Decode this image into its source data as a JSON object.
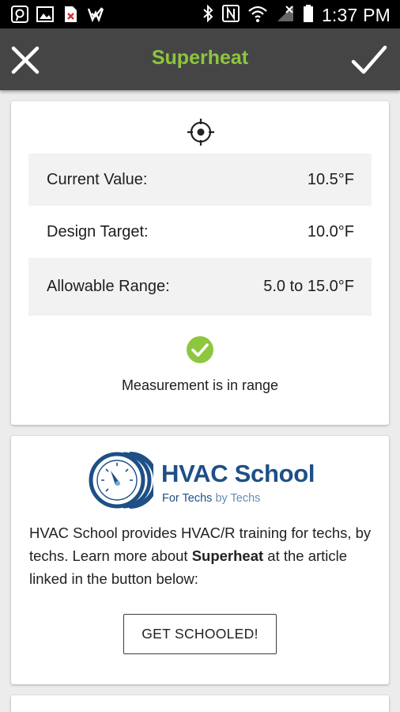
{
  "status_bar": {
    "time": "1:37 PM",
    "icons_left": [
      "pinterest-icon",
      "image-icon",
      "file-error-icon",
      "check-badge-icon"
    ],
    "icons_right": [
      "bluetooth-icon",
      "nfc-icon",
      "wifi-icon",
      "signal-icon",
      "battery-icon"
    ]
  },
  "app_bar": {
    "title": "Superheat",
    "close_icon": "close-icon",
    "confirm_icon": "check-icon",
    "title_color": "#8dc63f",
    "bar_color": "#454545"
  },
  "measurement": {
    "icon": "crosshair-icon",
    "rows": [
      {
        "label": "Current Value:",
        "value": "10.5°F"
      },
      {
        "label": "Design Target:",
        "value": "10.0°F"
      },
      {
        "label": "Allowable Range:",
        "value": "5.0 to 15.0°F"
      }
    ],
    "status_icon": "check-circle-icon",
    "status_color": "#8dc63f",
    "status_text": "Measurement is in range"
  },
  "school": {
    "logo_name": "HVAC School",
    "logo_tagline_bold": "For Techs",
    "logo_tagline_rest": "by Techs",
    "brand_color": "#1e4f86",
    "desc_before": "HVAC School provides HVAC/R training for techs, by techs. Learn more about ",
    "desc_bold": "Superheat",
    "desc_after": " at the article linked in the button below:",
    "button_label": "GET SCHOOLED!"
  }
}
